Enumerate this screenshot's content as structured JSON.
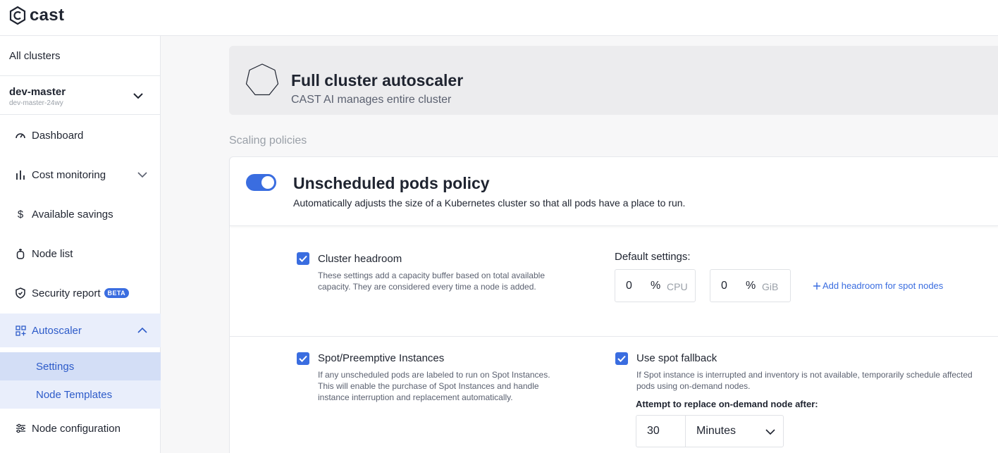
{
  "header": {
    "logo_text": "cast"
  },
  "sidebar": {
    "all_clusters": "All clusters",
    "cluster": {
      "name": "dev-master",
      "id": "dev-master-24wy"
    },
    "items": [
      {
        "label": "Dashboard",
        "icon": "dashboard-gauge-icon"
      },
      {
        "label": "Cost monitoring",
        "icon": "bar-chart-icon"
      },
      {
        "label": "Available savings",
        "icon": "dollar-icon"
      },
      {
        "label": "Node list",
        "icon": "node-icon"
      },
      {
        "label": "Security report",
        "icon": "shield-icon",
        "badge": "BETA"
      },
      {
        "label": "Autoscaler",
        "icon": "autoscaler-grid-icon"
      },
      {
        "label": "Node configuration",
        "icon": "sliders-icon"
      }
    ],
    "autoscaler_sub": [
      {
        "label": "Settings"
      },
      {
        "label": "Node Templates"
      }
    ]
  },
  "hero": {
    "title": "Full cluster autoscaler",
    "subtitle": "CAST AI manages entire cluster"
  },
  "section_label": "Scaling policies",
  "policy": {
    "title": "Unscheduled pods policy",
    "description": "Automatically adjusts the size of a Kubernetes cluster so that all pods have a place to run.",
    "enabled": true,
    "headroom": {
      "title": "Cluster headroom",
      "desc_line1": "These settings add a capacity buffer based on total available",
      "desc_line2": "capacity. They are considered every time a node is added.",
      "defaults_label": "Default settings:",
      "cpu_value": "0",
      "cpu_pct": "%",
      "cpu_unit": "CPU",
      "mem_value": "0",
      "mem_pct": "%",
      "mem_unit": "GiB",
      "add_spot_link": "Add headroom for spot nodes"
    },
    "spot": {
      "title": "Spot/Preemptive Instances",
      "desc_line1": "If any unscheduled pods are labeled to run on Spot Instances.",
      "desc_line2": "This will enable the purchase of Spot Instances and handle",
      "desc_line3": "instance interruption and replacement automatically."
    },
    "fallback": {
      "title": "Use spot fallback",
      "desc_line1": "If Spot instance is interrupted and inventory is not available, temporarily schedule affected",
      "desc_line2": "pods using on-demand nodes.",
      "attempt_label": "Attempt to replace on-demand node after:",
      "attempt_value": "30",
      "attempt_unit": "Minutes"
    }
  },
  "colors": {
    "accent": "#3a6de0",
    "nav_active_bg": "#d3def6",
    "nav_group_bg": "#e9eefb"
  }
}
